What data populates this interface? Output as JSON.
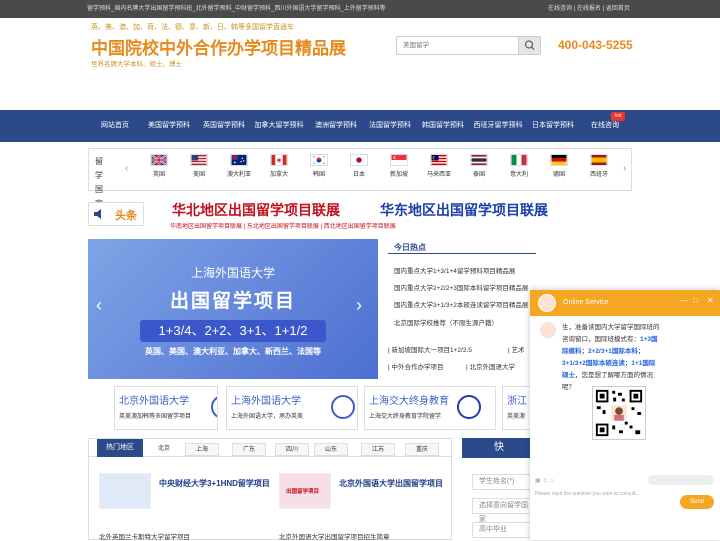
{
  "topbar": {
    "left_text": "留学预科_国内名牌大学出国留学预科班_北外留学预科_中财留学预科_西川外国语大学留学预科_上外留学预科等",
    "links": [
      "在线咨询",
      "在线报名",
      "返回首页"
    ]
  },
  "header": {
    "tagline_countries": "英、美、澳、加、荷、法、德、意、新、日、韩等多国留学直通车",
    "logo_text": "中国院校中外合作办学项目精品展",
    "tagline_degrees": "世界名牌大学本科、硕士、博士",
    "search_placeholder": "美国留学",
    "phone": "400-043-5255"
  },
  "nav": {
    "items": [
      "网站首页",
      "美国留学预科",
      "英国留学预科",
      "加拿大留学预科",
      "澳洲留学预科",
      "法国留学预科",
      "韩国留学预科",
      "西班牙留学预科",
      "日本留学预科",
      "在线咨询"
    ],
    "hot_badge": "hot"
  },
  "countries": {
    "label": "留学国家",
    "items": [
      "英国",
      "美国",
      "澳大利亚",
      "加拿大",
      "韩国",
      "日本",
      "新加坡",
      "马来西亚",
      "泰国",
      "意大利",
      "德国",
      "西班牙"
    ],
    "arrow_prev": "‹",
    "arrow_next": "›"
  },
  "headline": {
    "label": "头条",
    "title_north": "华北地区出国留学项目联展",
    "title_east": "华东地区出国留学项目联展",
    "sub_links": "华南地区出国留学项目联展 | 东北地区出国留学项目联展 | 西北地区出国留学项目联展"
  },
  "banner": {
    "school": "上海外国语大学",
    "title": "出国留学项目",
    "programs": "1+3/4、2+2、3+1、1+1/2",
    "countries": "英国、美国、澳大利亚、加拿大、新西兰、法国等",
    "arrow_prev": "‹",
    "arrow_next": "›"
  },
  "hot_news": {
    "title": "今日热点",
    "items": [
      "国内重点大学1+3/1+4留学预科项目精品展",
      "国内重点大学2+2/2+3国际本科留学项目精品展",
      "国内重点大学3+1/3+2本硕连读留学项目精品展",
      "北京国际学校推荐（不限生源户籍）"
    ],
    "row1_a": "| 新加坡国际大一项目1+2/2.5",
    "row1_b": "| 艺术",
    "row2_a": "| 中外合作办学项目",
    "row2_b": "| 北京外国语大学"
  },
  "schools": [
    {
      "name": "北京外国语大学",
      "sub": "英美澳加韩等多国留学项目"
    },
    {
      "name": "上海外国语大学",
      "sub": "上海外国语大学，承办英美"
    },
    {
      "name": "上海交大终身教育",
      "sub": "上海交大终身教育学院留学"
    },
    {
      "name": "浙江",
      "sub": "英美澳"
    }
  ],
  "hot_area": {
    "tab_label": "热门地区",
    "tabs": [
      "北京",
      "上海",
      "广东",
      "四川",
      "山东",
      "江苏",
      "重庆"
    ],
    "card1_title": "中央财经大学3+1HND留学项目",
    "card2_title": "北京外国语大学出国留学项目",
    "card2_img_text": "出国留学项目",
    "list_left": "北外英国兰卡斯特大学留学项目",
    "list_right": "北京外国语大学出国留学项目招生简章"
  },
  "form": {
    "title": "快",
    "name_placeholder": "学生姓名(*)",
    "country_placeholder": "选择意向留学国家",
    "grade_placeholder": "高中毕业"
  },
  "chat": {
    "service_title": "Online Service",
    "message_parts": [
      "生，准备读国内大学留学国际班的咨询窗口，国际班模式有：",
      "1+3国际模科",
      "；",
      "2+2/3+1国际本科",
      "；",
      "3+1/3+2国际本硕连读",
      "；",
      "1+1国际硕士",
      "，您是想了解哪方面的情况呢？"
    ],
    "input_placeholder": "Please input the question you want to consult...",
    "send_label": "Send"
  },
  "colors": {
    "nav_blue": "#2c4a8a",
    "brand_orange": "#e8891c",
    "headline_red": "#c0101e",
    "headline_blue": "#1b3ea8",
    "chat_orange": "#f5a623"
  }
}
